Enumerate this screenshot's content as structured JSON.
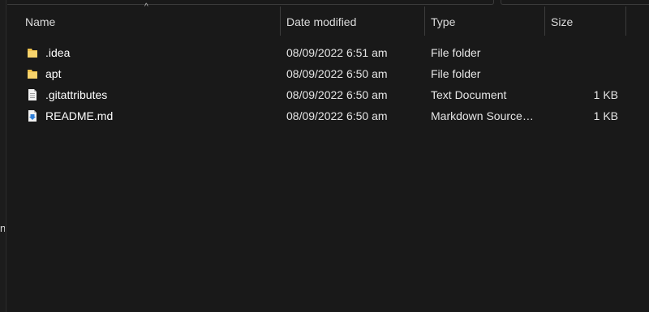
{
  "columns": {
    "name": "Name",
    "date": "Date modified",
    "type": "Type",
    "size": "Size"
  },
  "sort_indicator": "^",
  "nav_pane_glyph": "n",
  "files": [
    {
      "name": ".idea",
      "date": "08/09/2022 6:51 am",
      "type": "File folder",
      "size": "",
      "icon": "folder-icon"
    },
    {
      "name": "apt",
      "date": "08/09/2022 6:50 am",
      "type": "File folder",
      "size": "",
      "icon": "folder-icon"
    },
    {
      "name": ".gitattributes",
      "date": "08/09/2022 6:50 am",
      "type": "Text Document",
      "size": "1 KB",
      "icon": "text-file-icon"
    },
    {
      "name": "README.md",
      "date": "08/09/2022 6:50 am",
      "type": "Markdown Source…",
      "size": "1 KB",
      "icon": "markdown-file-icon"
    }
  ],
  "colors": {
    "background": "#191919",
    "folder": "#f0c24b",
    "markdown_accent": "#2f7fd8",
    "separator": "#3c3c3c"
  }
}
